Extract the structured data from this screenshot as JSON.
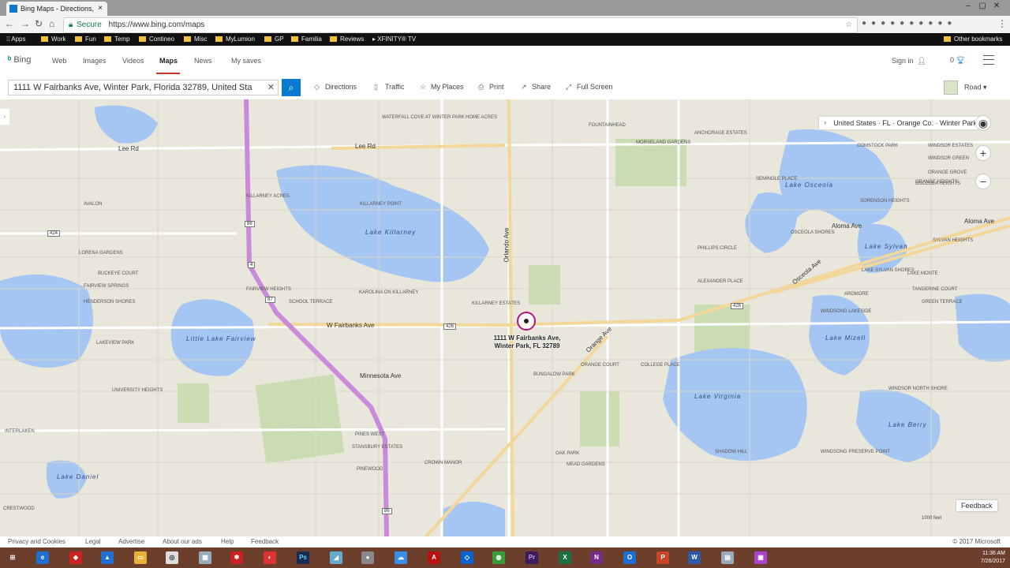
{
  "browser": {
    "tab_title": "Bing Maps - Directions,",
    "tab_close": "×",
    "secure_label": "Secure",
    "url": "https://www.bing.com/maps",
    "bookmarks": [
      "Apps",
      "Work",
      "Fun",
      "Temp",
      "Contineo",
      "Misc",
      "MyLumion",
      "GP",
      "Familia",
      "Reviews",
      "XFINITY® TV",
      "Other bookmarks"
    ]
  },
  "bing": {
    "logo": "Bing",
    "nav": [
      "Web",
      "Images",
      "Videos",
      "Maps",
      "News",
      "My saves"
    ],
    "active_nav": "Maps",
    "sign_in": "Sign in",
    "rewards_count": "0"
  },
  "toolbar": {
    "search_value": "1111 W Fairbanks Ave, Winter Park, Florida 32789, United Sta",
    "directions": "Directions",
    "traffic": "Traffic",
    "my_places": "My Places",
    "print": "Print",
    "share": "Share",
    "full_screen": "Full Screen",
    "map_style": "Road"
  },
  "map": {
    "breadcrumb": "United States · FL · Orange Co. · Winter Park",
    "pin_label": "1111 W Fairbanks Ave, Winter Park, FL 32789",
    "feedback": "Feedback",
    "scale": "1000 feet",
    "lakes": [
      "Lake Killarney",
      "Lake Osceola",
      "Little Lake Fairview",
      "Lake Virginia",
      "Lake Mizell",
      "Lake Sylvan",
      "Lake Berry",
      "Lake Daniel"
    ],
    "roads": [
      "Lee Rd",
      "W Fairbanks Ave",
      "Aloma Ave",
      "Osceola Ave",
      "Orlando Ave",
      "Orange Ave",
      "Minnesota Ave"
    ],
    "places": [
      "WATERFALL COVE AT WINTER PARK",
      "HOME ACRES",
      "FOUNTAINHEAD",
      "MORSELAND GARDENS",
      "ANCHORAGE ESTATES",
      "KILLARNEY ACRES",
      "KILLARNEY POINT",
      "AVALON",
      "LORENA GARDENS",
      "BUCKEYE COURT",
      "FAIRVIEW SPRINGS",
      "HENDERSON SHORES",
      "FAIRVIEW HEIGHTS",
      "SCHOOL TERRACE",
      "KAROLINA ON KILLARNEY",
      "KILLARNEY ESTATES",
      "PHILLIPS CIRCLE",
      "ALEXANDER PLACE",
      "ORANGE COURT",
      "BUNGALOW PARK",
      "COLLEGE PLACE",
      "SHADOW HILL",
      "WINDSOR NORTH SHORE",
      "WINDSONG PRESERVE POINT",
      "LAKEVIEW PARK",
      "UNIVERSITY HEIGHTS",
      "INTERLAKEN",
      "CRESTWOOD",
      "PINES WEST",
      "STANSBURY ESTATES",
      "PINEWOOD",
      "CROWN MANOR",
      "OAK PARK",
      "MEAD GARDENS",
      "ORANGE HEIGHTS",
      "WINDSONG LAKESIDE",
      "ARDMORE",
      "TANGERINE COURT",
      "GREEN TERRACE",
      "LAKE MONTE",
      "SYLVAN HEIGHTS",
      "OSCEOLA SHORES",
      "LAKE SYLVAN SHORES",
      "SEMINOLE PLACE",
      "COMSTOCK PARK",
      "OSCEOLA HEIGHTS",
      "SORENSON HEIGHTS",
      "WINDSOR GREEN",
      "ORANGE GROVE",
      "WINDSOR ESTATES"
    ],
    "shields": [
      "424",
      "88",
      "4",
      "87",
      "426",
      "426",
      "86"
    ]
  },
  "footer": {
    "links": [
      "Privacy and Cookies",
      "Legal",
      "Advertise",
      "About our ads",
      "Help",
      "Feedback"
    ],
    "copyright": "© 2017 Microsoft",
    "time": "11:36 AM",
    "date": "7/26/2017"
  },
  "colors": {
    "water": "#a5c5f2",
    "land": "#e9e6dc",
    "park": "#c9dcb2",
    "highway": "#c98ad9",
    "accent": "#0a7ad1"
  }
}
